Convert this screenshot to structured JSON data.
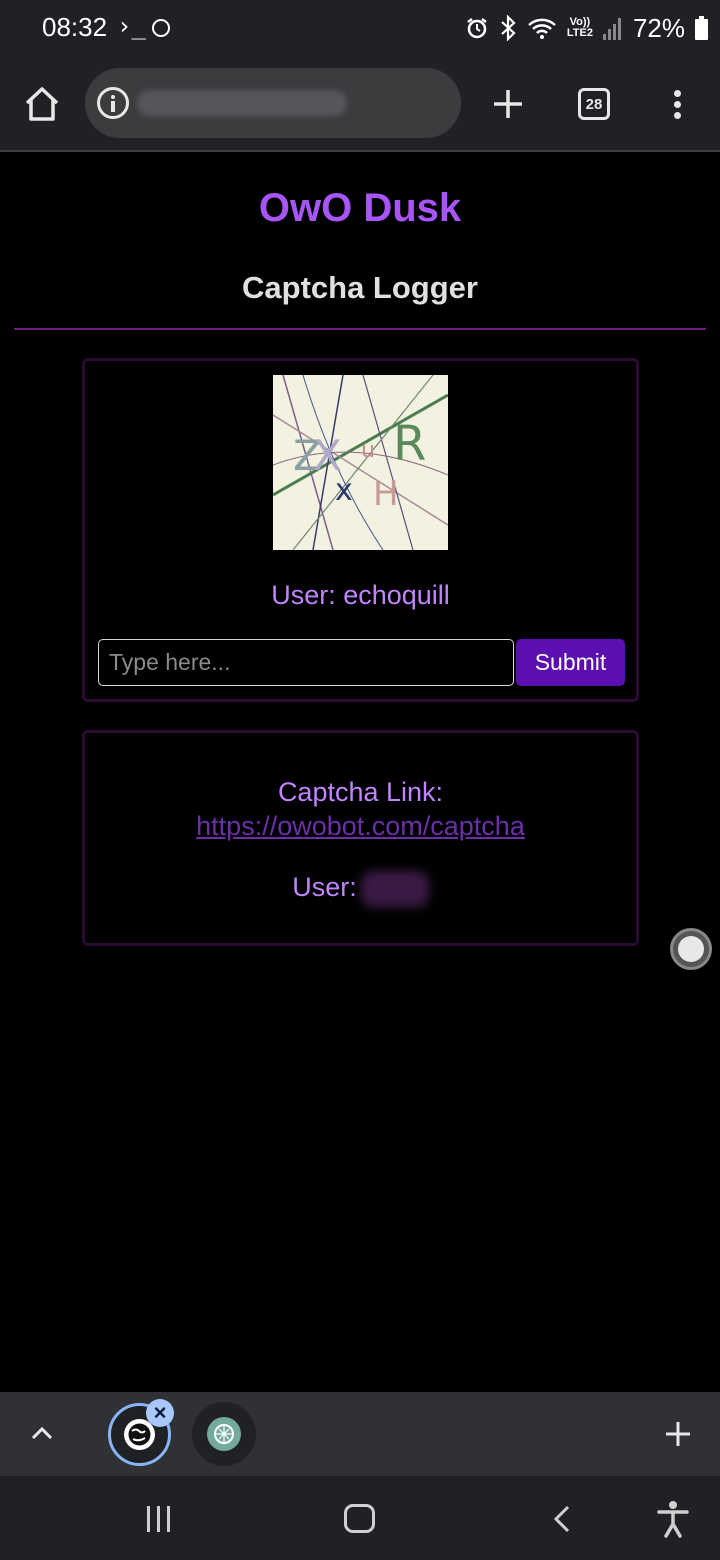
{
  "status_bar": {
    "time": "08:32",
    "terminal_glyph": "›_",
    "network_label_top": "Vo))",
    "network_label_bottom": "LTE2",
    "battery_percent": "72%"
  },
  "browser": {
    "tab_count": "28"
  },
  "page": {
    "site_title": "OwO Dusk",
    "heading": "Captcha Logger",
    "captcha_card": {
      "user_label": "User: echoquill",
      "input_placeholder": "Type here...",
      "submit_label": "Submit"
    },
    "link_card": {
      "link_label": "Captcha Link:",
      "link_url": "https://owobot.com/captcha",
      "user_prefix": "User:"
    }
  },
  "colors": {
    "accent_purple": "#a855f7",
    "label_purple": "#c084fc",
    "submit_bg": "#5b0fb0",
    "divider": "#6b1f7c"
  },
  "icons": {
    "home": "home-icon",
    "info": "info-icon",
    "new_tab": "plus-icon",
    "tabs": "tab-switcher-icon",
    "menu": "more-vert-icon",
    "collapse": "chevron-up-icon",
    "close": "close-icon"
  }
}
